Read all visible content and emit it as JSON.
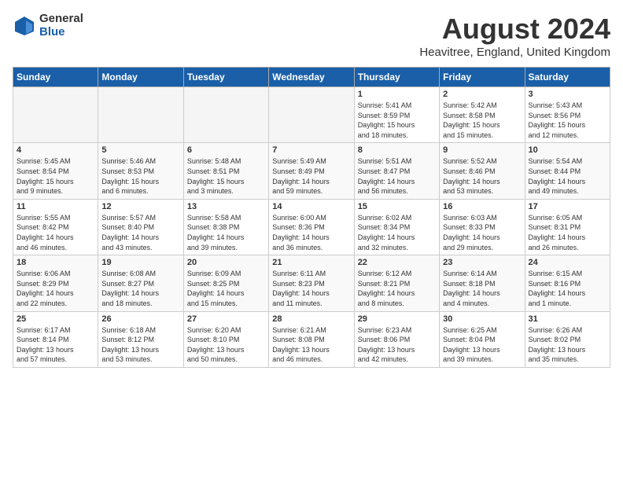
{
  "header": {
    "logo_general": "General",
    "logo_blue": "Blue",
    "month_title": "August 2024",
    "location": "Heavitree, England, United Kingdom"
  },
  "days_of_week": [
    "Sunday",
    "Monday",
    "Tuesday",
    "Wednesday",
    "Thursday",
    "Friday",
    "Saturday"
  ],
  "weeks": [
    [
      {
        "day": "",
        "info": ""
      },
      {
        "day": "",
        "info": ""
      },
      {
        "day": "",
        "info": ""
      },
      {
        "day": "",
        "info": ""
      },
      {
        "day": "1",
        "info": "Sunrise: 5:41 AM\nSunset: 8:59 PM\nDaylight: 15 hours\nand 18 minutes."
      },
      {
        "day": "2",
        "info": "Sunrise: 5:42 AM\nSunset: 8:58 PM\nDaylight: 15 hours\nand 15 minutes."
      },
      {
        "day": "3",
        "info": "Sunrise: 5:43 AM\nSunset: 8:56 PM\nDaylight: 15 hours\nand 12 minutes."
      }
    ],
    [
      {
        "day": "4",
        "info": "Sunrise: 5:45 AM\nSunset: 8:54 PM\nDaylight: 15 hours\nand 9 minutes."
      },
      {
        "day": "5",
        "info": "Sunrise: 5:46 AM\nSunset: 8:53 PM\nDaylight: 15 hours\nand 6 minutes."
      },
      {
        "day": "6",
        "info": "Sunrise: 5:48 AM\nSunset: 8:51 PM\nDaylight: 15 hours\nand 3 minutes."
      },
      {
        "day": "7",
        "info": "Sunrise: 5:49 AM\nSunset: 8:49 PM\nDaylight: 14 hours\nand 59 minutes."
      },
      {
        "day": "8",
        "info": "Sunrise: 5:51 AM\nSunset: 8:47 PM\nDaylight: 14 hours\nand 56 minutes."
      },
      {
        "day": "9",
        "info": "Sunrise: 5:52 AM\nSunset: 8:46 PM\nDaylight: 14 hours\nand 53 minutes."
      },
      {
        "day": "10",
        "info": "Sunrise: 5:54 AM\nSunset: 8:44 PM\nDaylight: 14 hours\nand 49 minutes."
      }
    ],
    [
      {
        "day": "11",
        "info": "Sunrise: 5:55 AM\nSunset: 8:42 PM\nDaylight: 14 hours\nand 46 minutes."
      },
      {
        "day": "12",
        "info": "Sunrise: 5:57 AM\nSunset: 8:40 PM\nDaylight: 14 hours\nand 43 minutes."
      },
      {
        "day": "13",
        "info": "Sunrise: 5:58 AM\nSunset: 8:38 PM\nDaylight: 14 hours\nand 39 minutes."
      },
      {
        "day": "14",
        "info": "Sunrise: 6:00 AM\nSunset: 8:36 PM\nDaylight: 14 hours\nand 36 minutes."
      },
      {
        "day": "15",
        "info": "Sunrise: 6:02 AM\nSunset: 8:34 PM\nDaylight: 14 hours\nand 32 minutes."
      },
      {
        "day": "16",
        "info": "Sunrise: 6:03 AM\nSunset: 8:33 PM\nDaylight: 14 hours\nand 29 minutes."
      },
      {
        "day": "17",
        "info": "Sunrise: 6:05 AM\nSunset: 8:31 PM\nDaylight: 14 hours\nand 26 minutes."
      }
    ],
    [
      {
        "day": "18",
        "info": "Sunrise: 6:06 AM\nSunset: 8:29 PM\nDaylight: 14 hours\nand 22 minutes."
      },
      {
        "day": "19",
        "info": "Sunrise: 6:08 AM\nSunset: 8:27 PM\nDaylight: 14 hours\nand 18 minutes."
      },
      {
        "day": "20",
        "info": "Sunrise: 6:09 AM\nSunset: 8:25 PM\nDaylight: 14 hours\nand 15 minutes."
      },
      {
        "day": "21",
        "info": "Sunrise: 6:11 AM\nSunset: 8:23 PM\nDaylight: 14 hours\nand 11 minutes."
      },
      {
        "day": "22",
        "info": "Sunrise: 6:12 AM\nSunset: 8:21 PM\nDaylight: 14 hours\nand 8 minutes."
      },
      {
        "day": "23",
        "info": "Sunrise: 6:14 AM\nSunset: 8:18 PM\nDaylight: 14 hours\nand 4 minutes."
      },
      {
        "day": "24",
        "info": "Sunrise: 6:15 AM\nSunset: 8:16 PM\nDaylight: 14 hours\nand 1 minute."
      }
    ],
    [
      {
        "day": "25",
        "info": "Sunrise: 6:17 AM\nSunset: 8:14 PM\nDaylight: 13 hours\nand 57 minutes."
      },
      {
        "day": "26",
        "info": "Sunrise: 6:18 AM\nSunset: 8:12 PM\nDaylight: 13 hours\nand 53 minutes."
      },
      {
        "day": "27",
        "info": "Sunrise: 6:20 AM\nSunset: 8:10 PM\nDaylight: 13 hours\nand 50 minutes."
      },
      {
        "day": "28",
        "info": "Sunrise: 6:21 AM\nSunset: 8:08 PM\nDaylight: 13 hours\nand 46 minutes."
      },
      {
        "day": "29",
        "info": "Sunrise: 6:23 AM\nSunset: 8:06 PM\nDaylight: 13 hours\nand 42 minutes."
      },
      {
        "day": "30",
        "info": "Sunrise: 6:25 AM\nSunset: 8:04 PM\nDaylight: 13 hours\nand 39 minutes."
      },
      {
        "day": "31",
        "info": "Sunrise: 6:26 AM\nSunset: 8:02 PM\nDaylight: 13 hours\nand 35 minutes."
      }
    ]
  ]
}
